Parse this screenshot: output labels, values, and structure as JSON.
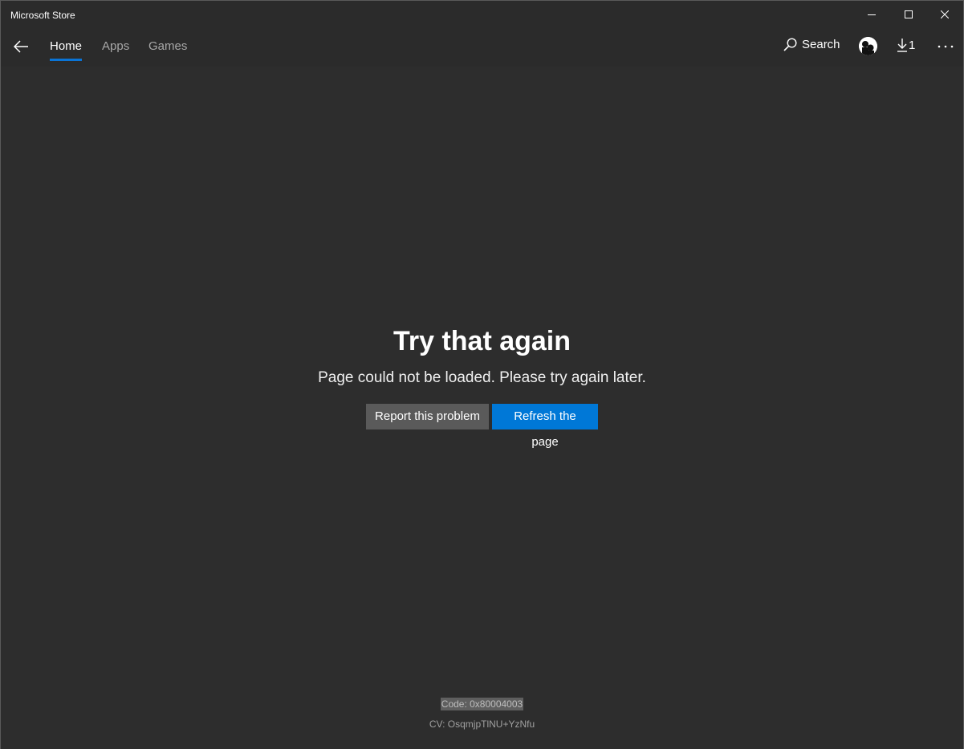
{
  "window": {
    "title": "Microsoft Store",
    "controls": [
      "minimize",
      "maximize",
      "close"
    ]
  },
  "nav": {
    "back_icon": "arrow-left-icon",
    "tabs": [
      {
        "label": "Home",
        "active": true
      },
      {
        "label": "Apps",
        "active": false
      },
      {
        "label": "Games",
        "active": false
      }
    ],
    "search_label": "Search",
    "downloads_count": "1",
    "more_icon": "ellipsis-icon"
  },
  "error": {
    "heading": "Try that again",
    "message": "Page could not be loaded. Please try again later.",
    "report_button": "Report this problem",
    "refresh_button": "Refresh the page",
    "code": "Code: 0x80004003",
    "cv": "CV: OsqmjpTlNU+YzNfu"
  },
  "colors": {
    "accent": "#0078d7",
    "tab_indicator": "#0a74d6",
    "background": "#2d2d2d",
    "secondary_button": "#5a5a5a"
  }
}
